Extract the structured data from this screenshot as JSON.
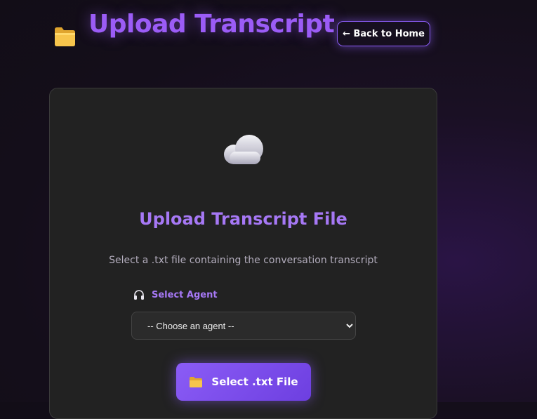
{
  "header": {
    "icon": "folder-icon",
    "title": "Upload Transcript",
    "back_button_label": "← Back to Home"
  },
  "card": {
    "icon": "cloud-icon",
    "heading": "Upload Transcript File",
    "subtitle": "Select a .txt file containing the conversation transcript",
    "agent": {
      "icon": "headphones-icon",
      "label": "Select Agent",
      "selected": "-- Choose an agent --"
    },
    "select_button": {
      "icon": "folder-icon",
      "label": "Select .txt File"
    }
  },
  "colors": {
    "accent": "#9b5cf6",
    "card_bg": "#222222",
    "page_bg": "#140e1a"
  }
}
